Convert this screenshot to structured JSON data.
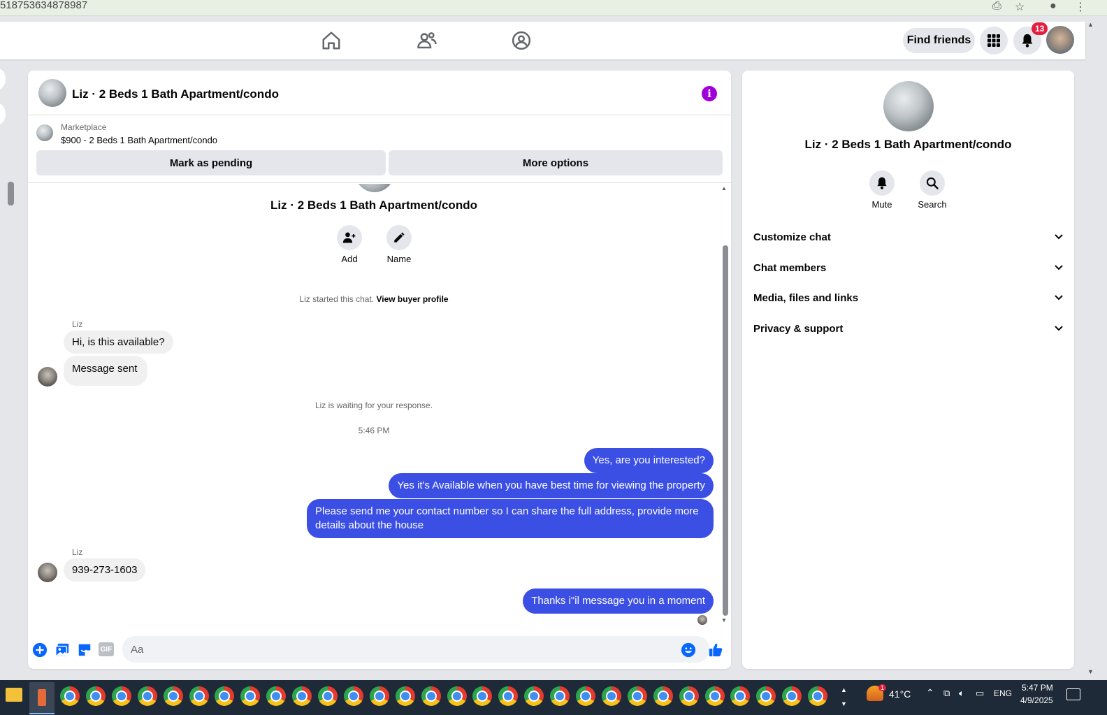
{
  "browser": {
    "url_fragment": "518753634878987"
  },
  "topnav": {
    "find_friends_label": "Find friends",
    "notification_count": "13"
  },
  "chat": {
    "title": "Liz · 2 Beds 1 Bath Apartment/condo",
    "marketplace_label": "Marketplace",
    "listing": "$900 - 2 Beds 1 Bath Apartment/condo",
    "mark_pending_label": "Mark as pending",
    "more_options_label": "More options",
    "center_name": "Liz · 2 Beds 1 Bath Apartment/condo",
    "add_label": "Add",
    "name_label": "Name",
    "started_text": "Liz started this chat.",
    "view_buyer_profile": "View buyer profile",
    "waiting_text": "Liz is waiting for your response.",
    "timestamp": "5:46 PM",
    "messages": [
      {
        "sender": "Liz",
        "text": "Hi, is this available?"
      },
      {
        "sender": "Liz",
        "text": "Message sent"
      },
      {
        "sender": "me",
        "text": "Yes, are you interested?"
      },
      {
        "sender": "me",
        "text": "Yes it's Available when you have best time for viewing the property"
      },
      {
        "sender": "me",
        "text": "Please send me your contact number so I can share the full address, provide more details about the house"
      },
      {
        "sender": "Liz",
        "text": "939-273-1603"
      },
      {
        "sender": "me",
        "text": "Thanks i\"il message you in a moment"
      }
    ],
    "composer_placeholder": "Aa",
    "gif_label": "GIF"
  },
  "info_panel": {
    "name": "Liz · 2 Beds 1 Bath Apartment/condo",
    "mute_label": "Mute",
    "search_label": "Search",
    "sections": [
      "Customize chat",
      "Chat members",
      "Media, files and links",
      "Privacy & support"
    ]
  },
  "taskbar": {
    "weather": "41°C",
    "weather_alert": "1",
    "language": "ENG",
    "time": "5:47 PM",
    "date": "4/9/2025"
  },
  "colors": {
    "outgoing_bubble": "#3b4fe4",
    "incoming_bubble": "#f0f0f0",
    "accent_blue": "#0866ff",
    "info_purple": "#a000d8",
    "badge_red": "#e41e3f"
  },
  "icons": [
    "home-icon",
    "friends-icon",
    "groups-icon",
    "apps-grid-icon",
    "bell-icon",
    "info-icon",
    "add-person-icon",
    "pencil-icon",
    "plus-icon",
    "photo-icon",
    "sticker-icon",
    "gif-icon",
    "emoji-icon",
    "thumbs-up-icon",
    "mute-bell-icon",
    "search-icon",
    "chevron-down-icon"
  ]
}
